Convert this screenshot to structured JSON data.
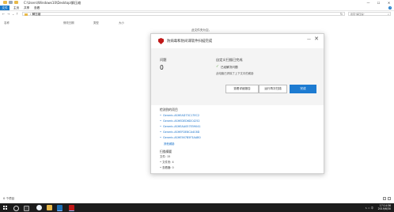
{
  "window": {
    "path_title": "C:\\Users\\Windows10\\Desktop\\解压缩",
    "controls": {
      "minimize": "—",
      "maximize": "☐",
      "close": "✕"
    }
  },
  "ribbon": {
    "tabs": [
      "文件",
      "主页",
      "共享",
      "查看"
    ],
    "help": "?"
  },
  "address": {
    "back": "←",
    "forward": "→",
    "recent": "⌄",
    "up": "↑",
    "breadcrumb": "› 解压缩",
    "refresh": "↻",
    "search_placeholder": "搜索\"解压缩\"",
    "search_icon": "⌕"
  },
  "columns": [
    "名称",
    "修改日期",
    "类型",
    "大小"
  ],
  "empty_message": "此文件夹为空。",
  "status": {
    "items": "0 个项目"
  },
  "dialog": {
    "title": "防病毒和防间谍软件扫描完成",
    "minimize": "—",
    "close": "✕",
    "issues_label": "问题",
    "issues_count": "0",
    "scan_title": "自定义扫描已完成",
    "check_icon": "✓",
    "scan_line1": "已经解决问题",
    "scan_line2": "此电脑已清除了上下文中的威胁",
    "buttons": {
      "view_report": "查看详细报告",
      "run_again": "运行再次扫描",
      "close": "完成"
    },
    "detected_title": "检测到的项目",
    "threats": [
      "Generic.ASHEAD73C17EC2",
      "Generic.ASHEDED6DC4252",
      "Generic.ASHEAA057E59041",
      "Generic.ASHEFDE8CA4C6D",
      "Generic.ASHE567B5F3AAB0"
    ],
    "bullet": "•",
    "more": "其他威胁",
    "summary_title": "扫描摘要",
    "summary": [
      "文件: 15",
      "• 文件夹: 4",
      "• 查看器: 0"
    ]
  },
  "taskbar": {
    "time": "17:14:36",
    "date": "2019/6/30",
    "tray": "∧ ▭ 中"
  },
  "colors": {
    "accent": "#1d7bd1",
    "mcafee_red": "#c01818",
    "link": "#1570c9",
    "success": "#4a9f2c"
  }
}
